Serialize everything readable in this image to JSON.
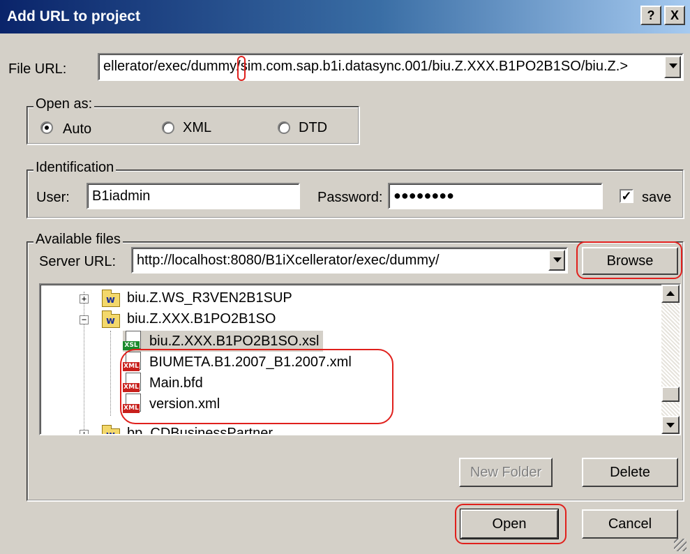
{
  "window": {
    "title": "Add URL to project",
    "help_label": "?",
    "close_label": "X"
  },
  "file_url": {
    "label": "File URL:",
    "value": "ellerator/exec/dummy/sim.com.sap.b1i.datasync.001/biu.Z.XXX.B1PO2B1SO/biu.Z.>"
  },
  "open_as": {
    "legend": "Open as:",
    "options": [
      "Auto",
      "XML",
      "DTD"
    ],
    "selected": "Auto"
  },
  "identification": {
    "legend": "Identification",
    "user_label": "User:",
    "user_value": "B1iadmin",
    "password_label": "Password:",
    "password_value": "●●●●●●●●",
    "save_label": "save",
    "save_checked": true
  },
  "available_files": {
    "legend": "Available files",
    "server_url_label": "Server URL:",
    "server_url_value": "http://localhost:8080/B1iXcellerator/exec/dummy/",
    "browse_label": "Browse",
    "tree": [
      {
        "label": "biu.Z.WS_R3VEN2B1SUP",
        "kind": "folder",
        "icon_letter": "w",
        "expander": "+"
      },
      {
        "label": "biu.Z.XXX.B1PO2B1SO",
        "kind": "folder",
        "icon_letter": "w",
        "expander": "−"
      },
      {
        "label": "biu.Z.XXX.B1PO2B1SO.xsl",
        "kind": "xsl",
        "icon_tag": "XSL"
      },
      {
        "label": "BIUMETA.B1.2007_B1.2007.xml",
        "kind": "xml",
        "icon_tag": "XML"
      },
      {
        "label": "Main.bfd",
        "kind": "xml",
        "icon_tag": "XML"
      },
      {
        "label": "version.xml",
        "kind": "xml",
        "icon_tag": "XML"
      },
      {
        "label": "bp_CDBusinessPartner",
        "kind": "folder",
        "icon_letter": "w",
        "expander": "+"
      }
    ],
    "new_folder_label": "New Folder",
    "delete_label": "Delete"
  },
  "footer": {
    "open_label": "Open",
    "cancel_label": "Cancel"
  },
  "colors": {
    "dialog_bg": "#d4d0c8",
    "title_start": "#0a246a",
    "title_end": "#a6caf0",
    "highlight_mark": "#e0201c"
  }
}
